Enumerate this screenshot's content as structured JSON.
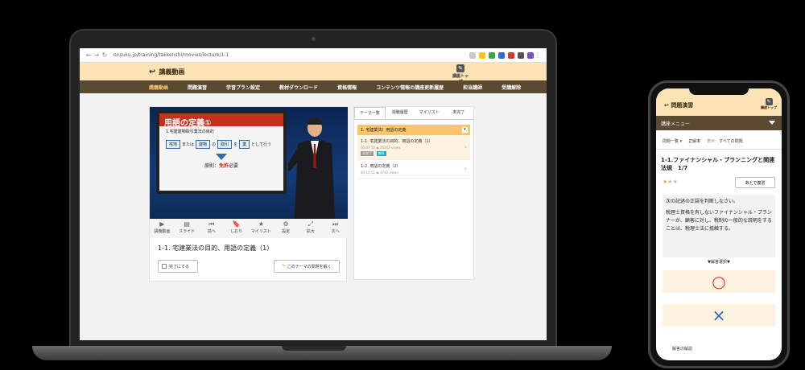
{
  "browser": {
    "url": "onsuku.jp/training/takkenshi/movies/lecture/1-1"
  },
  "header": {
    "title": "講義動画",
    "top_button_label": "講座トップ"
  },
  "nav": {
    "items": [
      "講義動画",
      "問題演習",
      "学習プラン設定",
      "教材ダウンロード",
      "資格情報",
      "コンテンツ情報の講座更新履歴",
      "担当講師",
      "受講解除"
    ]
  },
  "video": {
    "slide_title": "用語の定義①",
    "slide_subtitle": "1.宅建建物取引業法の目的",
    "slide_boxes": [
      "宅地",
      "または",
      "建物",
      "の",
      "取引",
      "を",
      "業",
      "として行う"
    ],
    "slide_footer_prefix": "原則：",
    "slide_footer_highlight": "免許",
    "slide_footer_suffix": "必要",
    "controls": [
      {
        "icon": "▶",
        "label": "講義動画"
      },
      {
        "icon": "▤",
        "label": "スライド"
      },
      {
        "icon": "⏮",
        "label": "前へ"
      },
      {
        "icon": "🔖",
        "label": "しおり"
      },
      {
        "icon": "★",
        "label": "マイリスト"
      },
      {
        "icon": "⚙",
        "label": "設定"
      },
      {
        "icon": "⤢",
        "label": "拡大"
      },
      {
        "icon": "⏭",
        "label": "次へ"
      }
    ],
    "title": "1-1. 宅建業法の目的、用語の定義（1）",
    "complete_label": "完了にする",
    "solve_label": "このテーマの問題を解く"
  },
  "side": {
    "tabs": [
      "テーマ一覧",
      "視聴履歴",
      "マイリスト",
      "未完了"
    ],
    "section_title": "1. 宅建業法）用語の定義",
    "items": [
      {
        "title": "1-1. 宅建業法の目的、用語の定義（1）",
        "meta": "00:07:16 ◉ 25243 views",
        "tags": [
          "未完了",
          "無料"
        ]
      },
      {
        "title": "1-2. 用語の定義（2）",
        "meta": "00:10:52 ◉ 4792 views",
        "tags": []
      }
    ]
  },
  "phone": {
    "header_title": "問題演習",
    "top_button_label": "講座トップ",
    "menu_label": "講座メニュー",
    "filter_list": "問題一覧",
    "filter_correct": "正解率",
    "filter_display_label": "表示：",
    "filter_display_value": "すべての問題",
    "question_title": "1-1.ファイナンシャル・プランニングと関連法規　1/7",
    "review_label": "あとで復習",
    "question_lead": "次の記述の正誤を判断しなさい。",
    "question_body": "税理士資格を有しないファイナンシャル・プランナーが、顧客に対し、税制の一般的な説明をすることは、税理士法に抵触する。",
    "select_label": "▼解答選択▼",
    "answer_true": "○",
    "answer_false": "×",
    "explanation_label": "解答の解説"
  },
  "colors": {
    "accent": "#f7c66b",
    "header_bg": "#fce3b5",
    "nav_bg": "#5a4a32",
    "correct": "#e0332b",
    "wrong": "#2b65c8"
  }
}
